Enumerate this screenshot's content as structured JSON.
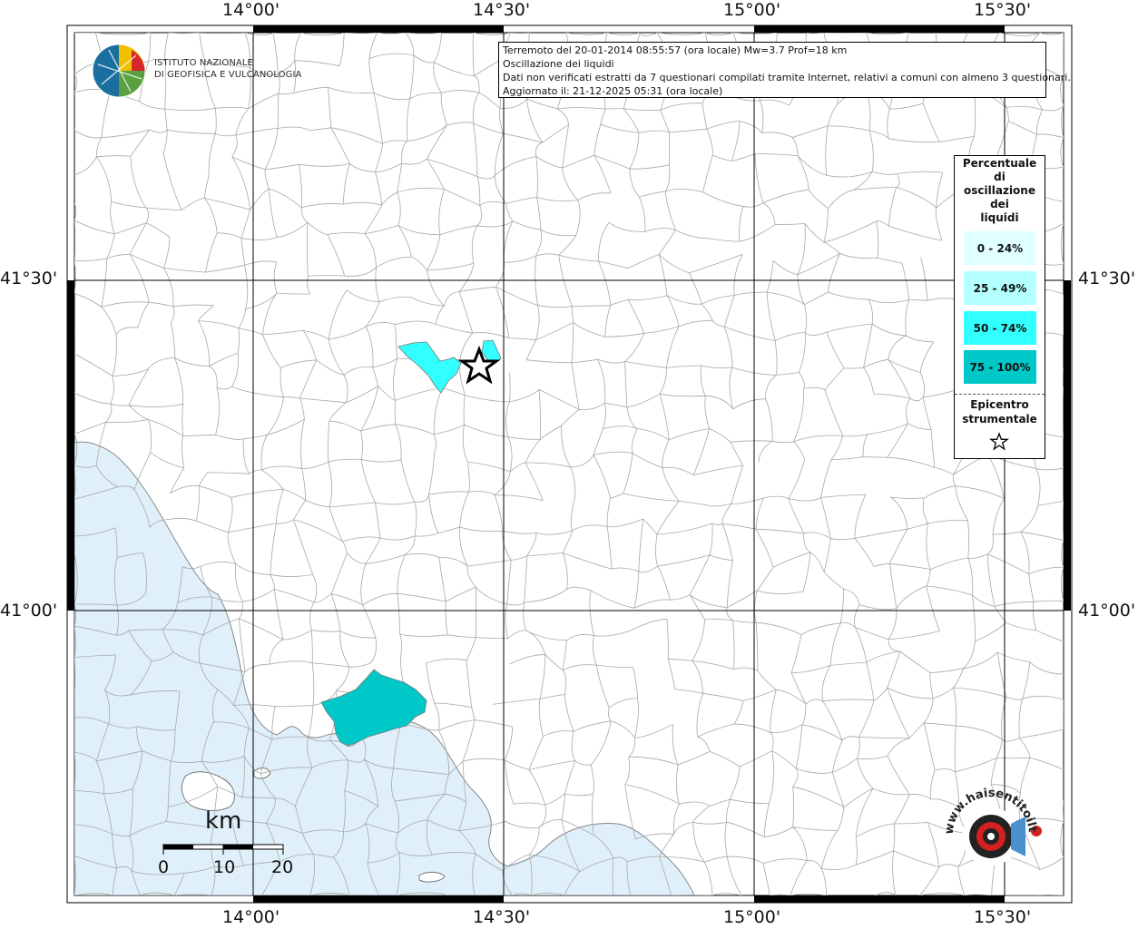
{
  "map": {
    "lon_labels": [
      "14°00'",
      "14°30'",
      "15°00'",
      "15°30'"
    ],
    "lat_labels": [
      "41°30'",
      "41°00'"
    ],
    "colors": {
      "land": "#ffffff",
      "sea": "#e0f0fa",
      "boundary": "#a8a8a8",
      "pct_0_24": "#e0ffff",
      "pct_25_49": "#b4ffff",
      "pct_50_74": "#32ffff",
      "pct_75_100": "#00c8c8"
    }
  },
  "info": {
    "line1": "Terremoto del 20-01-2014 08:55:57 (ora locale) Mw=3.7 Prof=18 km",
    "line2": "Oscillazione dei liquidi",
    "line3": "Dati non verificati estratti da 7 questionari compilati tramite Internet, relativi a comuni con almeno 3 questionari.",
    "line4": "Aggiornato il: 21-12-2025 05:31 (ora locale)"
  },
  "legend": {
    "title": [
      "Percentuale",
      "di",
      "oscillazione",
      "dei",
      "liquidi"
    ],
    "classes": [
      {
        "label": "0 - 24%",
        "color": "#e0ffff"
      },
      {
        "label": "25 - 49%",
        "color": "#b4ffff"
      },
      {
        "label": "50 - 74%",
        "color": "#32ffff"
      },
      {
        "label": "75 - 100%",
        "color": "#00c8c8"
      }
    ],
    "epicenter": [
      "Epicentro",
      "strumentale"
    ]
  },
  "logos": {
    "ingv_line1": "ISTITUTO NAZIONALE",
    "ingv_line2": "DI GEOFISICA E VULCANOLOGIA",
    "hst_text": "www.haisentitoilterremoto.it"
  },
  "scale": {
    "unit": "km",
    "ticks": [
      "0",
      "10",
      "20"
    ]
  },
  "epicenter_marker": "star-icon"
}
